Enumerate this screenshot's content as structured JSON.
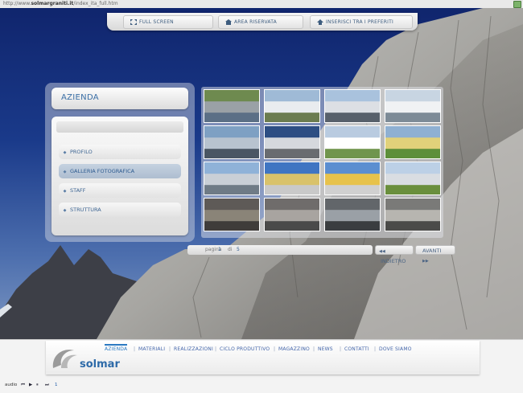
{
  "browser": {
    "url_prefix": "http://www.",
    "url_domain": "solmargraniti.it",
    "url_rest": "/index_ita_full.htm"
  },
  "topbar": [
    {
      "label": "FULL SCREEN",
      "icon": "fullscreen-icon"
    },
    {
      "label": "AREA RISERVATA",
      "icon": "house-icon"
    },
    {
      "label": "INSERISCI TRA I PREFERITI",
      "icon": "home-icon"
    }
  ],
  "section": {
    "title": "AZIENDA"
  },
  "menu": [
    {
      "label": "PROFILO",
      "active": false
    },
    {
      "label": "GALLERIA FOTOGRAFICA",
      "active": true
    },
    {
      "label": "STAFF",
      "active": false
    },
    {
      "label": "STRUTTURA",
      "active": false
    }
  ],
  "pager": {
    "page_label": "pagina",
    "current": "1",
    "of_label": "di",
    "total": "5",
    "prev_label": "INDIETRO",
    "next_label": "AVANTI"
  },
  "thumbnails": [
    {
      "caption": "",
      "palette": [
        "#6e8a4f",
        "#9aa1a6",
        "#5b6f86"
      ]
    },
    {
      "caption": "",
      "palette": [
        "#9fbad6",
        "#e9ecef",
        "#6b7c50"
      ]
    },
    {
      "caption": "",
      "palette": [
        "#a9c2dd",
        "#dcdfe4",
        "#57606b"
      ]
    },
    {
      "caption": "",
      "palette": [
        "#c8d5e2",
        "#f0f2f4",
        "#7d8b97"
      ]
    },
    {
      "caption": "",
      "palette": [
        "#7ea0c3",
        "#b8c3cf",
        "#4a5663"
      ]
    },
    {
      "caption": "",
      "palette": [
        "#2d4e83",
        "#d5d8dd",
        "#696c70"
      ]
    },
    {
      "caption": "",
      "palette": [
        "#b9cbe0",
        "#ffffff",
        "#70954d"
      ]
    },
    {
      "caption": "",
      "palette": [
        "#8fb0d2",
        "#e1d17a",
        "#5d8f3a"
      ]
    },
    {
      "caption": "",
      "palette": [
        "#8fb2d8",
        "#c9cfd6",
        "#6f7b86"
      ]
    },
    {
      "caption": "",
      "palette": [
        "#3f75c2",
        "#d9c26a",
        "#c9c9c9"
      ]
    },
    {
      "caption": "",
      "palette": [
        "#5b8ed0",
        "#e7c24b",
        "#d0d0d0"
      ]
    },
    {
      "caption": "",
      "palette": [
        "#bcd0e6",
        "#d9dde2",
        "#6a8f3d"
      ]
    },
    {
      "caption": "",
      "palette": [
        "#5e5a57",
        "#8a8478",
        "#3f3c3a"
      ]
    },
    {
      "caption": "",
      "palette": [
        "#6f6c6b",
        "#a8a4a0",
        "#4a4a4a"
      ]
    },
    {
      "caption": "",
      "palette": [
        "#62666a",
        "#9aa0a6",
        "#3a3d40"
      ]
    },
    {
      "caption": "",
      "palette": [
        "#7a7a78",
        "#b7b5b0",
        "#4b4b49"
      ]
    }
  ],
  "brand": {
    "name": "solmar"
  },
  "nav": [
    {
      "label": "AZIENDA",
      "active": true
    },
    {
      "label": "MATERIALI",
      "active": false
    },
    {
      "label": "REALIZZAZIONI",
      "active": false
    },
    {
      "label": "CICLO PRODUTTIVO",
      "active": false
    },
    {
      "label": "MAGAZZINO",
      "active": false
    },
    {
      "label": "NEWS",
      "active": false
    },
    {
      "label": "CONTATTI",
      "active": false
    },
    {
      "label": "DOVE SIAMO",
      "active": false
    }
  ],
  "audio": {
    "label": "audio",
    "track": "1"
  },
  "colors": {
    "accent": "#2b7ac2",
    "menu_active_bg": "#aebdd0",
    "sky": "#1a3a8a"
  }
}
